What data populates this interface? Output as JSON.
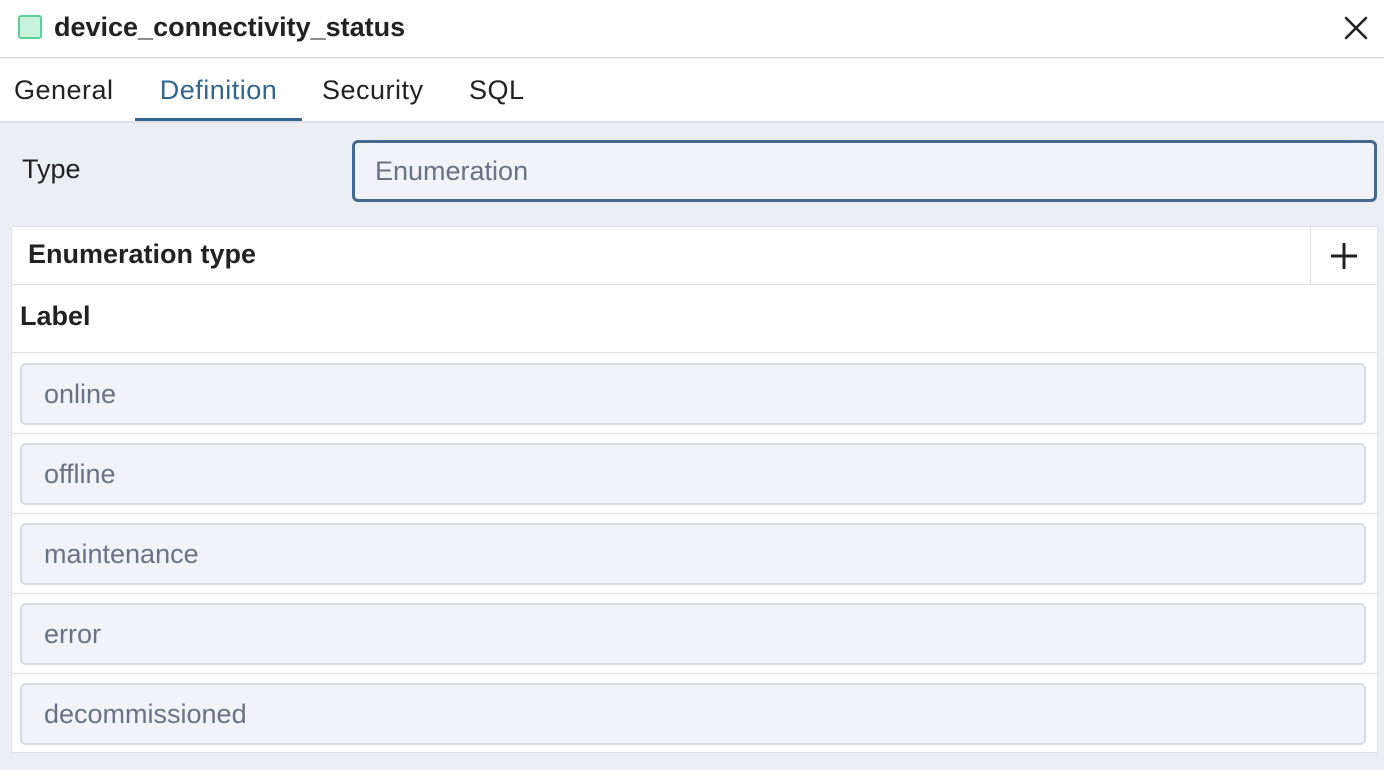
{
  "window": {
    "title": "device_connectivity_status",
    "type_icon": "type-icon",
    "close_icon": "close-icon"
  },
  "tabs": [
    {
      "label": "General",
      "active": false
    },
    {
      "label": "Definition",
      "active": true
    },
    {
      "label": "Security",
      "active": false
    },
    {
      "label": "SQL",
      "active": false
    }
  ],
  "form": {
    "type_label": "Type",
    "type_value": "Enumeration"
  },
  "enum_grid": {
    "title": "Enumeration type",
    "add_icon": "plus-icon",
    "column_header": "Label",
    "rows": [
      "online",
      "offline",
      "maintenance",
      "error",
      "decommissioned"
    ]
  },
  "colors": {
    "accent": "#326690",
    "icon_fill": "#c9f2dd",
    "icon_border": "#5fcf98"
  }
}
